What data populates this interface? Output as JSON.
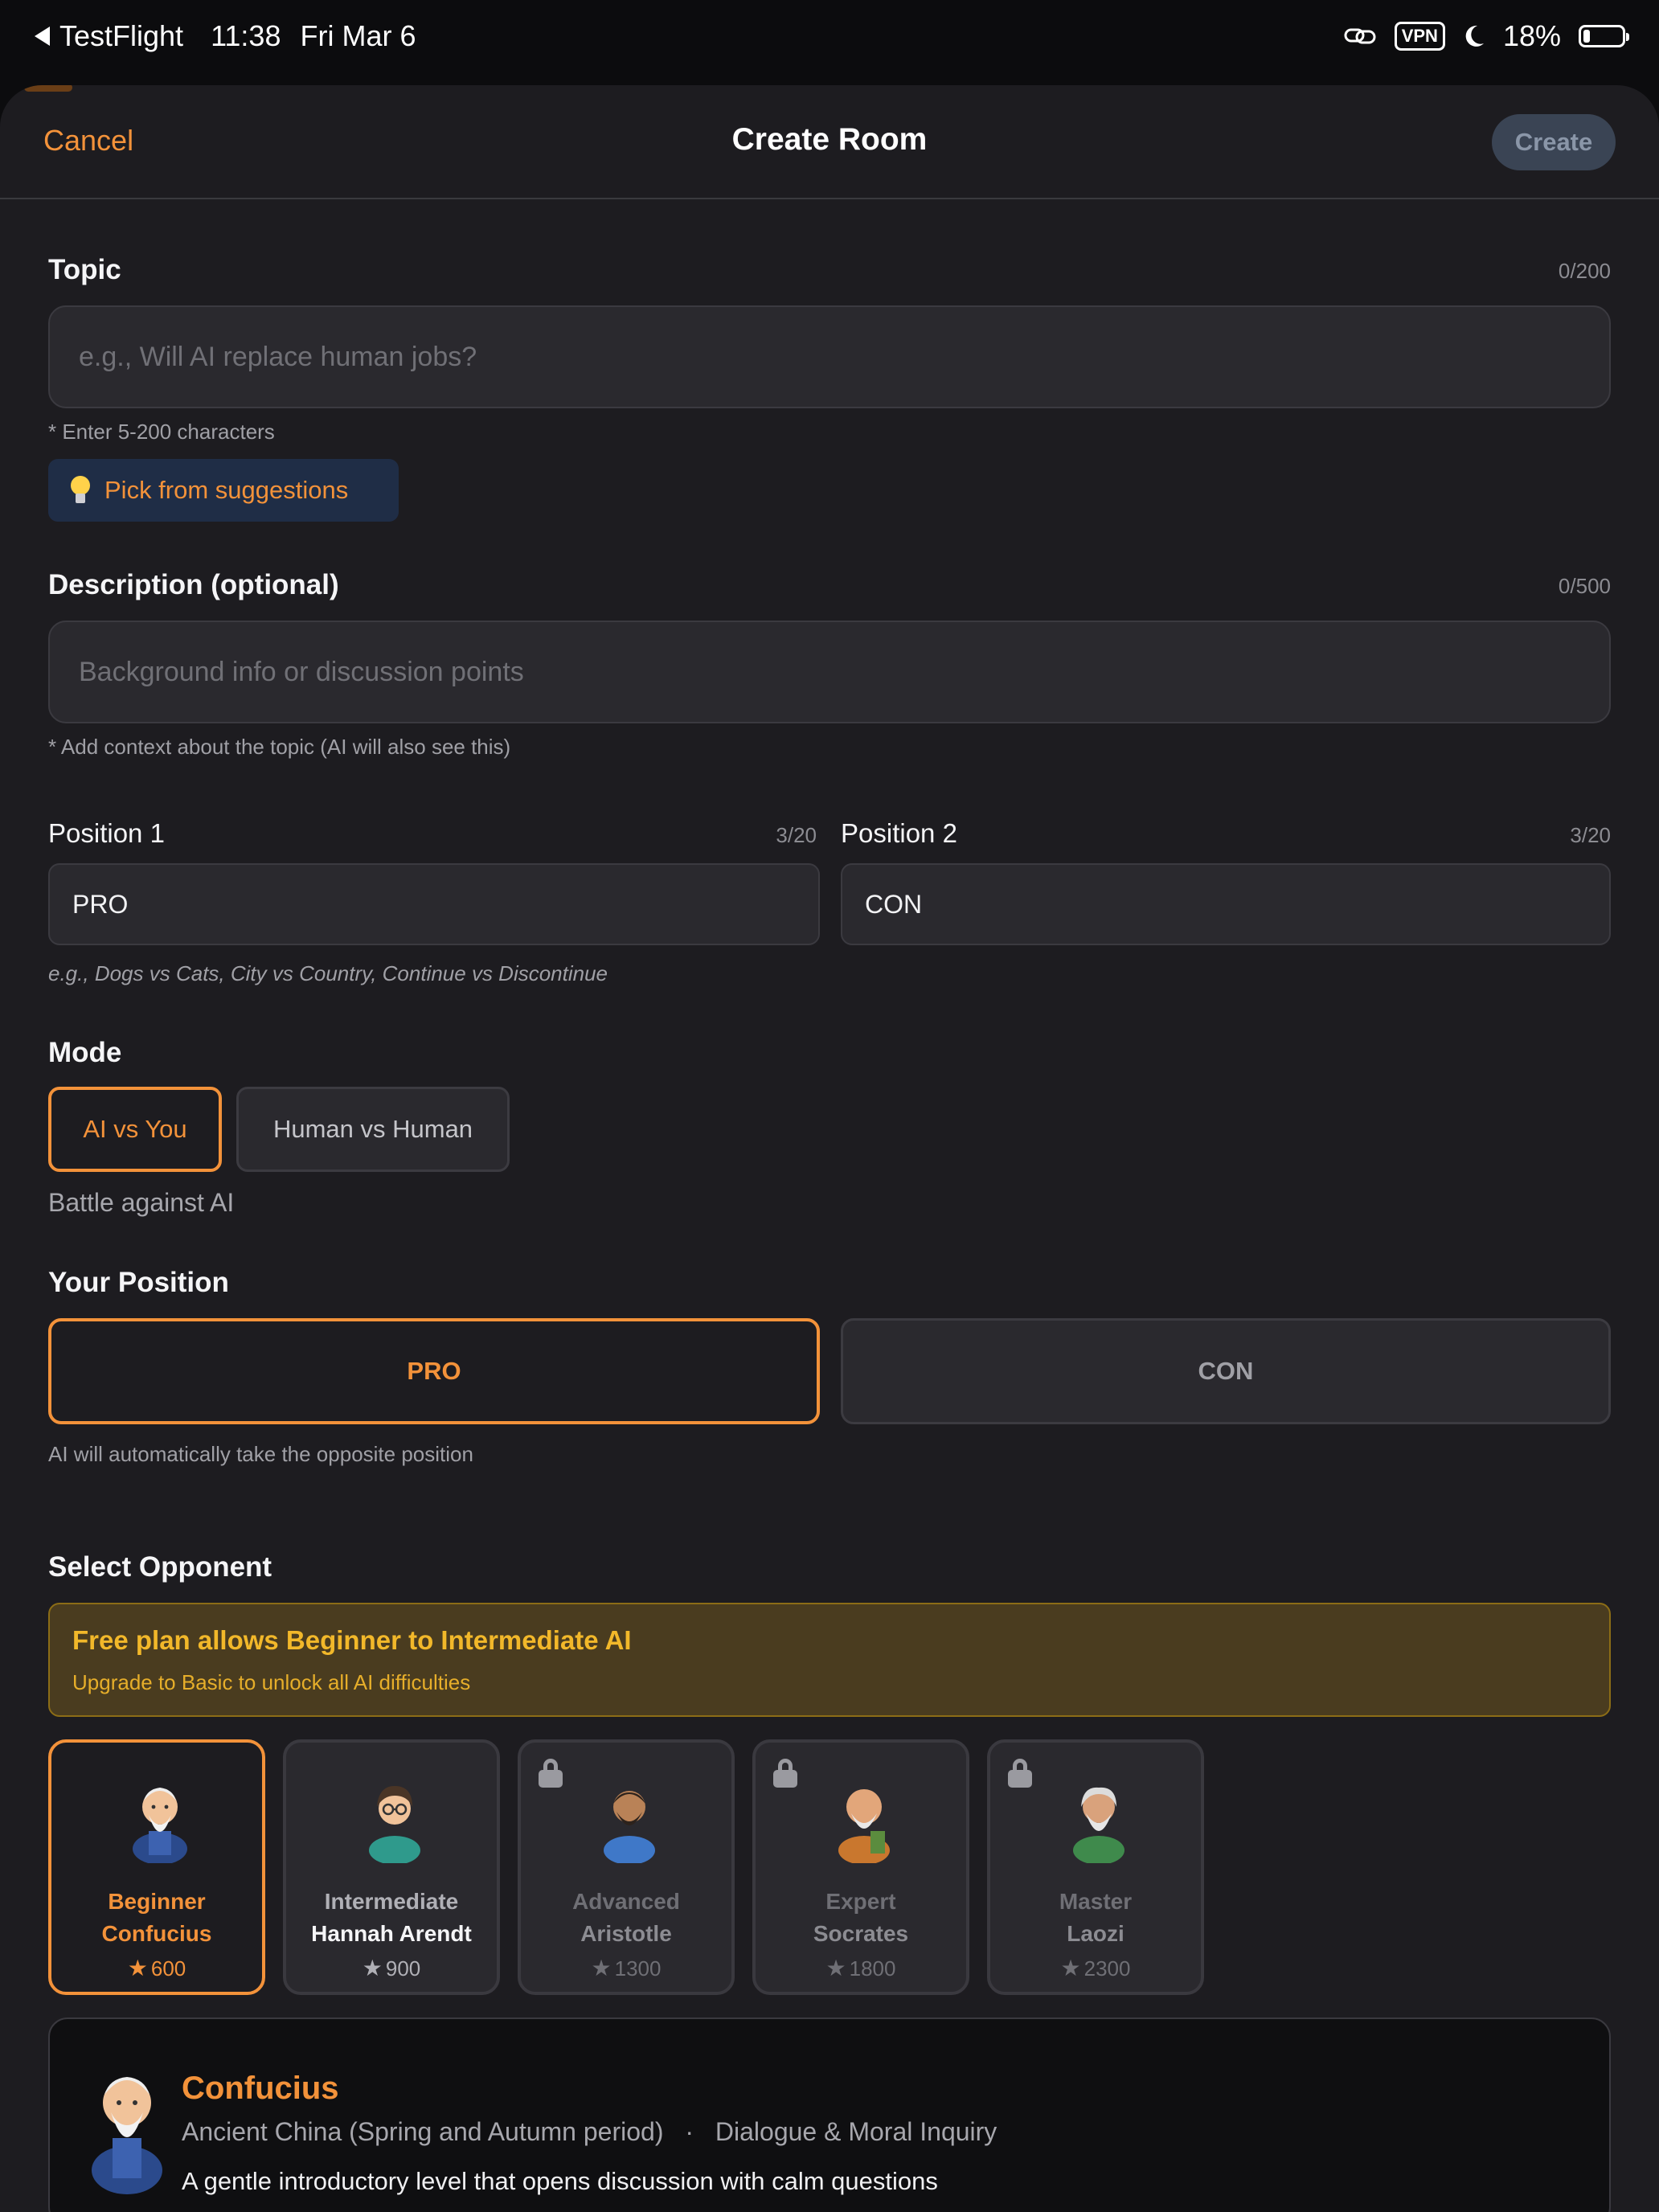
{
  "status_bar": {
    "back_app": "TestFlight",
    "time": "11:38",
    "date": "Fri Mar 6",
    "vpn": "VPN",
    "battery_percent": "18%",
    "battery_level": 0.18
  },
  "nav": {
    "cancel": "Cancel",
    "title": "Create Room",
    "create": "Create"
  },
  "topic": {
    "label": "Topic",
    "counter": "0/200",
    "placeholder": "e.g., Will AI replace human jobs?",
    "hint": "* Enter 5-200 characters",
    "suggest": "Pick from suggestions"
  },
  "description": {
    "label": "Description (optional)",
    "counter": "0/500",
    "placeholder": "Background info or discussion points",
    "hint": "* Add context about the topic (AI will also see this)"
  },
  "positions": {
    "p1_label": "Position 1",
    "p1_counter": "3/20",
    "p1_value": "PRO",
    "p2_label": "Position 2",
    "p2_counter": "3/20",
    "p2_value": "CON",
    "hint": "e.g., Dogs vs Cats, City vs Country, Continue vs Discontinue"
  },
  "mode": {
    "label": "Mode",
    "options": [
      "AI vs You",
      "Human vs Human"
    ],
    "selected": "AI vs You",
    "description": "Battle against AI"
  },
  "your_position": {
    "label": "Your Position",
    "options": [
      "PRO",
      "CON"
    ],
    "selected": "PRO",
    "hint": "AI will automatically take the opposite position"
  },
  "opponent": {
    "label": "Select Opponent",
    "banner_title": "Free plan allows Beginner to Intermediate AI",
    "banner_sub": "Upgrade to Basic to unlock all AI difficulties",
    "cards": [
      {
        "level": "Beginner",
        "name": "Confucius",
        "rating": "600",
        "locked": false,
        "selected": true
      },
      {
        "level": "Intermediate",
        "name": "Hannah Arendt",
        "rating": "900",
        "locked": false,
        "selected": false
      },
      {
        "level": "Advanced",
        "name": "Aristotle",
        "rating": "1300",
        "locked": true,
        "selected": false
      },
      {
        "level": "Expert",
        "name": "Socrates",
        "rating": "1800",
        "locked": true,
        "selected": false
      },
      {
        "level": "Master",
        "name": "Laozi",
        "rating": "2300",
        "locked": true,
        "selected": false
      }
    ],
    "star_glyph": "★"
  },
  "detail": {
    "name": "Confucius",
    "era": "Ancient China (Spring and Autumn period)",
    "separator": "·",
    "style": "Dialogue & Moral Inquiry",
    "description": "A gentle introductory level that opens discussion with calm questions"
  },
  "colors": {
    "accent": "#f3923a",
    "background": "#1d1c20",
    "field": "#2a292e",
    "banner": "#4a3c1f",
    "banner_text": "#f2b82a"
  }
}
